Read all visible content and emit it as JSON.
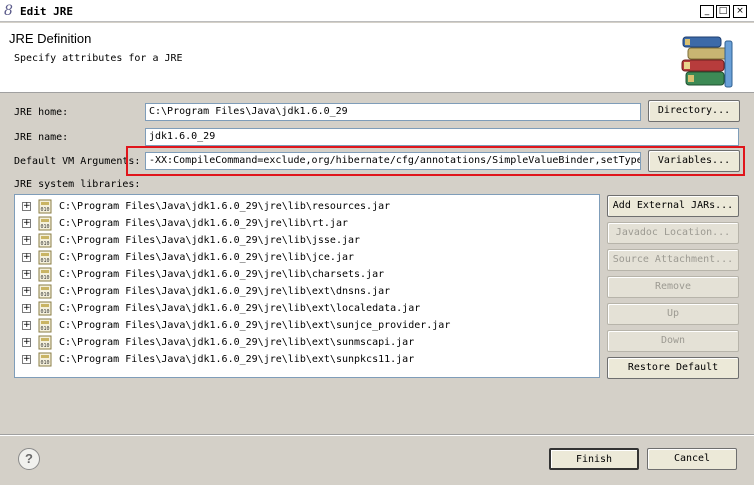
{
  "window": {
    "app_icon": "8",
    "title": "Edit JRE",
    "buttons": {
      "minimize": "_",
      "maximize": "□",
      "close": "×"
    }
  },
  "header": {
    "title": "JRE Definition",
    "subtitle": "Specify attributes for a JRE",
    "illustration": "books-icon"
  },
  "form": {
    "jre_home_label": "JRE home:",
    "jre_home_value": "C:\\Program Files\\Java\\jdk1.6.0_29",
    "directory_button": "Directory...",
    "jre_name_label": "JRE name:",
    "jre_name_value": "jdk1.6.0_29",
    "vm_args_label": "Default VM Arguments:",
    "vm_args_value": "-XX:CompileCommand=exclude,org/hibernate/cfg/annotations/SimpleValueBinder,setType",
    "variables_button": "Variables...",
    "libs_label": "JRE system libraries:"
  },
  "libraries": [
    {
      "label": "C:\\Program Files\\Java\\jdk1.6.0_29\\jre\\lib\\resources.jar"
    },
    {
      "label": "C:\\Program Files\\Java\\jdk1.6.0_29\\jre\\lib\\rt.jar"
    },
    {
      "label": "C:\\Program Files\\Java\\jdk1.6.0_29\\jre\\lib\\jsse.jar"
    },
    {
      "label": "C:\\Program Files\\Java\\jdk1.6.0_29\\jre\\lib\\jce.jar"
    },
    {
      "label": "C:\\Program Files\\Java\\jdk1.6.0_29\\jre\\lib\\charsets.jar"
    },
    {
      "label": "C:\\Program Files\\Java\\jdk1.6.0_29\\jre\\lib\\ext\\dnsns.jar"
    },
    {
      "label": "C:\\Program Files\\Java\\jdk1.6.0_29\\jre\\lib\\ext\\localedata.jar"
    },
    {
      "label": "C:\\Program Files\\Java\\jdk1.6.0_29\\jre\\lib\\ext\\sunjce_provider.jar"
    },
    {
      "label": "C:\\Program Files\\Java\\jdk1.6.0_29\\jre\\lib\\ext\\sunmscapi.jar"
    },
    {
      "label": "C:\\Program Files\\Java\\jdk1.6.0_29\\jre\\lib\\ext\\sunpkcs11.jar"
    }
  ],
  "side_buttons": {
    "add_external_jars": "Add External JARs...",
    "javadoc_location": "Javadoc Location...",
    "source_attachment": "Source Attachment...",
    "remove": "Remove",
    "up": "Up",
    "down": "Down",
    "restore_default": "Restore Default"
  },
  "footer": {
    "help": "?",
    "finish": "Finish",
    "cancel": "Cancel"
  },
  "colors": {
    "highlight": "#e0151b",
    "dialog_bg": "#d4d0c8"
  }
}
